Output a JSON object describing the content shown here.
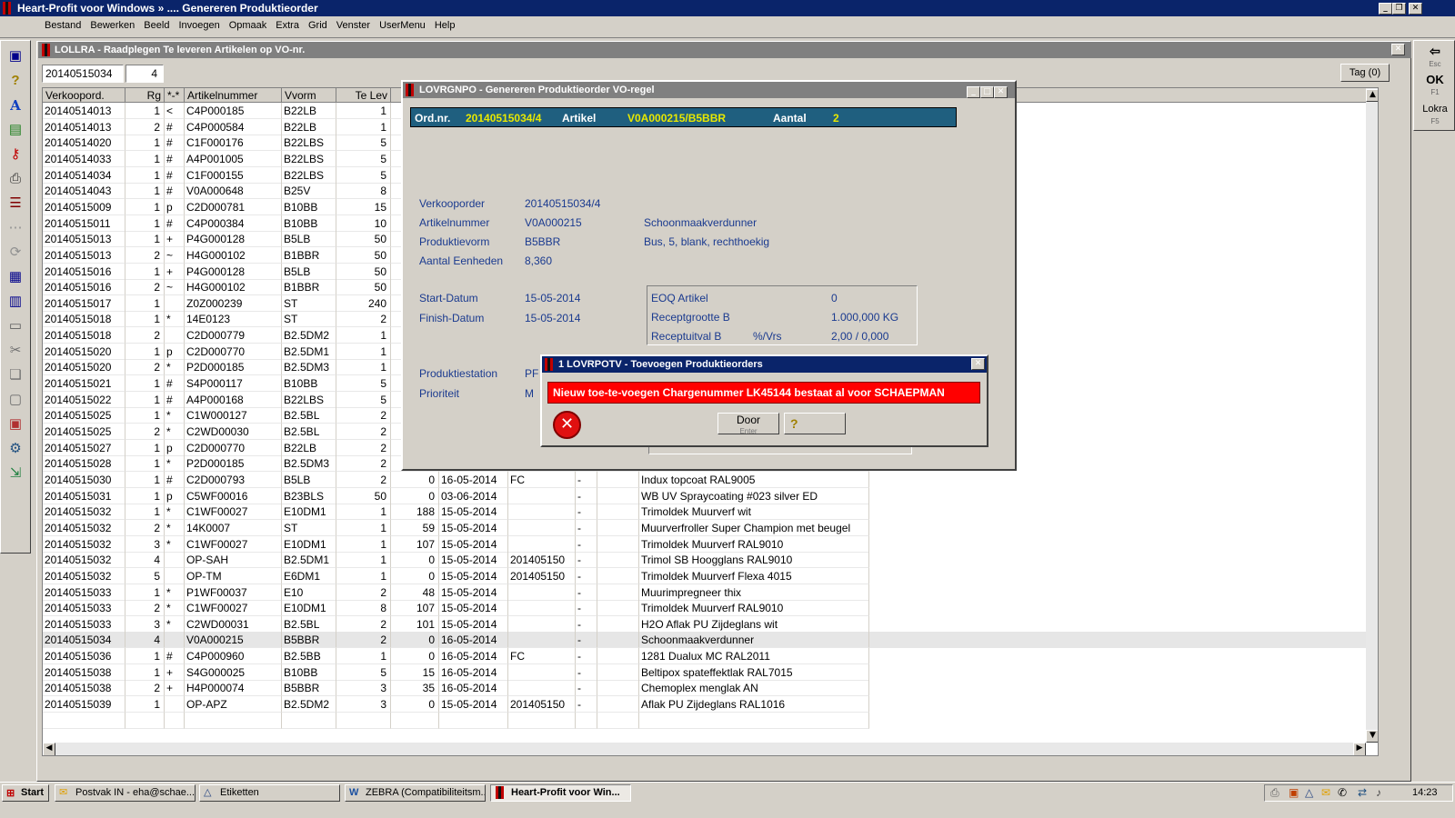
{
  "window_title": "Heart-Profit voor Windows  »  ....      Genereren Produktieorder",
  "menu": [
    "Bestand",
    "Bewerken",
    "Beeld",
    "Invoegen",
    "Opmaak",
    "Extra",
    "Grid",
    "Venster",
    "UserMenu",
    "Help"
  ],
  "child": {
    "title": "LOLLRA - Raadplegen Te leveren Artikelen op VO-nr.",
    "vo_value": "20140515034",
    "rg_value": "4",
    "tag_button": "Tag (0)"
  },
  "grid": {
    "headers": [
      "Verkoopord.",
      "Rg",
      "*-*",
      "Artikelnummer",
      "Vvorm",
      "Te Lev"
    ],
    "rows": [
      [
        "20140514013",
        "1",
        "<",
        "C4P000185",
        "B22LB",
        "1",
        "",
        "",
        "",
        "",
        ""
      ],
      [
        "20140514013",
        "2",
        "#",
        "C4P000584",
        "B22LB",
        "1",
        "",
        "",
        "",
        "",
        ""
      ],
      [
        "20140514020",
        "1",
        "#",
        "C1F000176",
        "B22LBS",
        "5",
        "",
        "",
        "",
        "",
        ""
      ],
      [
        "20140514033",
        "1",
        "#",
        "A4P001005",
        "B22LBS",
        "5",
        "",
        "",
        "",
        "",
        ""
      ],
      [
        "20140514034",
        "1",
        "#",
        "C1F000155",
        "B22LBS",
        "5",
        "",
        "",
        "",
        "",
        ""
      ],
      [
        "20140514043",
        "1",
        "#",
        "V0A000648",
        "B25V",
        "8",
        "",
        "",
        "",
        "",
        ""
      ],
      [
        "20140515009",
        "1",
        "p",
        "C2D000781",
        "B10BB",
        "15",
        "",
        "",
        "",
        "",
        ""
      ],
      [
        "20140515011",
        "1",
        "#",
        "C4P000384",
        "B10BB",
        "10",
        "",
        "",
        "",
        "",
        ""
      ],
      [
        "20140515013",
        "1",
        "+",
        "P4G000128",
        "B5LB",
        "50",
        "",
        "",
        "",
        "",
        ""
      ],
      [
        "20140515013",
        "2",
        "~",
        "H4G000102",
        "B1BBR",
        "50",
        "",
        "",
        "",
        "",
        ""
      ],
      [
        "20140515016",
        "1",
        "+",
        "P4G000128",
        "B5LB",
        "50",
        "",
        "",
        "",
        "",
        ""
      ],
      [
        "20140515016",
        "2",
        "~",
        "H4G000102",
        "B1BBR",
        "50",
        "",
        "",
        "",
        "",
        ""
      ],
      [
        "20140515017",
        "1",
        "",
        "Z0Z000239",
        "ST",
        "240",
        "",
        "",
        "",
        "",
        ""
      ],
      [
        "20140515018",
        "1",
        "*",
        "14E0123",
        "ST",
        "2",
        "",
        "",
        "",
        "",
        ""
      ],
      [
        "20140515018",
        "2",
        "",
        "C2D000779",
        "B2.5DM2",
        "1",
        "",
        "",
        "",
        "",
        ""
      ],
      [
        "20140515020",
        "1",
        "p",
        "C2D000770",
        "B2.5DM1",
        "1",
        "",
        "",
        "",
        "",
        ""
      ],
      [
        "20140515020",
        "2",
        "*",
        "P2D000185",
        "B2.5DM3",
        "1",
        "",
        "",
        "",
        "",
        ""
      ],
      [
        "20140515021",
        "1",
        "#",
        "S4P000117",
        "B10BB",
        "5",
        "",
        "",
        "",
        "",
        ""
      ],
      [
        "20140515022",
        "1",
        "#",
        "A4P000168",
        "B22LBS",
        "5",
        "",
        "",
        "",
        "",
        ""
      ],
      [
        "20140515025",
        "1",
        "*",
        "C1W000127",
        "B2.5BL",
        "2",
        "",
        "",
        "",
        "",
        ""
      ],
      [
        "20140515025",
        "2",
        "*",
        "C2WD00030",
        "B2.5BL",
        "2",
        "",
        "",
        "",
        "",
        ""
      ],
      [
        "20140515027",
        "1",
        "p",
        "C2D000770",
        "B22LB",
        "2",
        "",
        "",
        "",
        "",
        ""
      ],
      [
        "20140515028",
        "1",
        "*",
        "P2D000185",
        "B2.5DM3",
        "2",
        "",
        "",
        "",
        "",
        ""
      ],
      [
        "20140515030",
        "1",
        "#",
        "C2D000793",
        "B5LB",
        "2",
        "0",
        "16-05-2014",
        "FC",
        "-",
        "Indux topcoat RAL9005"
      ],
      [
        "20140515031",
        "1",
        "p",
        "C5WF00016",
        "B23BLS",
        "50",
        "0",
        "03-06-2014",
        "",
        "-",
        "WB UV Spraycoating #023 silver ED"
      ],
      [
        "20140515032",
        "1",
        "*",
        "C1WF00027",
        "E10DM1",
        "1",
        "188",
        "15-05-2014",
        "",
        "-",
        "Trimoldek Muurverf wit"
      ],
      [
        "20140515032",
        "2",
        "*",
        "14K0007",
        "ST",
        "1",
        "59",
        "15-05-2014",
        "",
        "-",
        "Muurverfroller Super Champion met beugel"
      ],
      [
        "20140515032",
        "3",
        "*",
        "C1WF00027",
        "E10DM1",
        "1",
        "107",
        "15-05-2014",
        "",
        "-",
        "Trimoldek Muurverf RAL9010"
      ],
      [
        "20140515032",
        "4",
        "",
        "OP-SAH",
        "B2.5DM1",
        "1",
        "0",
        "15-05-2014",
        "201405150",
        "-",
        "Trimol SB Hoogglans RAL9010"
      ],
      [
        "20140515032",
        "5",
        "",
        "OP-TM",
        "E6DM1",
        "1",
        "0",
        "15-05-2014",
        "201405150",
        "-",
        "Trimoldek Muurverf Flexa 4015"
      ],
      [
        "20140515033",
        "1",
        "*",
        "P1WF00037",
        "E10",
        "2",
        "48",
        "15-05-2014",
        "",
        "-",
        "Muurimpregneer thix"
      ],
      [
        "20140515033",
        "2",
        "*",
        "C1WF00027",
        "E10DM1",
        "8",
        "107",
        "15-05-2014",
        "",
        "-",
        "Trimoldek Muurverf RAL9010"
      ],
      [
        "20140515033",
        "3",
        "*",
        "C2WD00031",
        "B2.5BL",
        "2",
        "101",
        "15-05-2014",
        "",
        "-",
        "H2O Aflak PU Zijdeglans wit"
      ],
      [
        "20140515034",
        "4",
        "",
        "V0A000215",
        "B5BBR",
        "2",
        "0",
        "16-05-2014",
        "",
        "-",
        "Schoonmaakverdunner"
      ],
      [
        "20140515036",
        "1",
        "#",
        "C4P000960",
        "B2.5BB",
        "1",
        "0",
        "16-05-2014",
        "FC",
        "-",
        "1281 Dualux MC RAL2011"
      ],
      [
        "20140515038",
        "1",
        "+",
        "S4G000025",
        "B10BB",
        "5",
        "15",
        "16-05-2014",
        "",
        "-",
        "Beltipox spateffektlak RAL7015"
      ],
      [
        "20140515038",
        "2",
        "+",
        "H4P000074",
        "B5BBR",
        "3",
        "35",
        "16-05-2014",
        "",
        "-",
        "Chemoplex menglak AN"
      ],
      [
        "20140515039",
        "1",
        "",
        "OP-APZ",
        "B2.5DM2",
        "3",
        "0",
        "15-05-2014",
        "201405150",
        "-",
        "Aflak PU Zijdeglans RAL1016"
      ]
    ],
    "selected_row": 33
  },
  "lov": {
    "title": "LOVRGNPO - Genereren Produktieorder VO-regel",
    "bar": {
      "ord_label": "Ord.nr.",
      "ord_value": "20140515034/4",
      "art_label": "Artikel",
      "art_value": "V0A000215/B5BBR",
      "aantal_label": "Aantal",
      "aantal_value": "2"
    },
    "verkooporder_label": "Verkooporder",
    "verkooporder_value": "20140515034/4",
    "artikel_label": "Artikelnummer",
    "artikel_value": "V0A000215",
    "artikel_desc": "Schoonmaakverdunner",
    "vorm_label": "Produktievorm",
    "vorm_value": "B5BBR",
    "vorm_desc": "Bus, 5, blank, rechthoekig",
    "eenheden_label": "Aantal Eenheden",
    "eenheden_value": "8,360",
    "start_label": "Start-Datum",
    "start_value": "15-05-2014",
    "finish_label": "Finish-Datum",
    "finish_value": "15-05-2014",
    "eoq_label": "EOQ Artikel",
    "eoq_value": "0",
    "receptgrootte_label": "Receptgrootte B",
    "receptgrootte_value": "1.000,000 KG",
    "receptuitval_label": "Receptuitval  B",
    "receptuitval_unit": "%/Vrs",
    "receptuitval_value": "2,00 / 0,000",
    "station_label": "Produktiestation",
    "station_value": "PF",
    "prio_label": "Prioriteit",
    "prio_value": "M"
  },
  "error": {
    "title": "1 LOVRPOTV - Toevoegen Produktieorders",
    "message": "Nieuw toe-te-voegen Chargenummer LK45144 bestaat al voor SCHAEPMAN",
    "door_label": "Door",
    "door_sub": "Enter"
  },
  "right_toolbar": [
    {
      "label": "Esc"
    },
    {
      "label": "OK",
      "sub": "F1"
    },
    {
      "label": "Lokra",
      "sub": "F5"
    }
  ],
  "taskbar": {
    "start": "Start",
    "items": [
      "Postvak IN - eha@schae...",
      "Etiketten",
      "ZEBRA (Compatibiliteitsm...",
      "Heart-Profit voor Win..."
    ],
    "clock": "14:23"
  },
  "colors": {
    "title_active": "#0a246a",
    "title_inactive": "#808080",
    "lov_bar": "#1f5f7f",
    "lov_value": "#e8e800",
    "error_red": "#ff0000"
  }
}
